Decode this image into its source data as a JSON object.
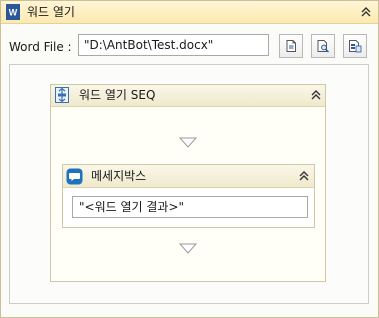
{
  "activity": {
    "title": "워드 열기",
    "icon": "word-document-icon",
    "collapse_icon": "double-chevron-up-icon"
  },
  "file": {
    "label": "Word File :",
    "value": "\"D:\\AntBot\\Test.docx\"",
    "buttons": [
      {
        "name": "new-file-button",
        "icon": "blank-document-icon"
      },
      {
        "name": "browse-file-button",
        "icon": "document-search-icon"
      },
      {
        "name": "fields-button",
        "icon": "document-fields-icon"
      }
    ]
  },
  "sequence": {
    "title": "워드 열기 SEQ",
    "icon": "sequence-icon",
    "collapse_icon": "double-chevron-up-icon",
    "drop_icon": "drop-arrow-icon"
  },
  "messagebox": {
    "title": "메세지박스",
    "icon": "message-bubble-icon",
    "collapse_icon": "double-chevron-up-icon",
    "value": "\"<워드 열기 결과>\""
  },
  "colors": {
    "header_bg": "#fbe9b0",
    "seq_header_bg": "#efe9cd",
    "word_blue": "#2b579a",
    "message_blue": "#1e73be"
  }
}
